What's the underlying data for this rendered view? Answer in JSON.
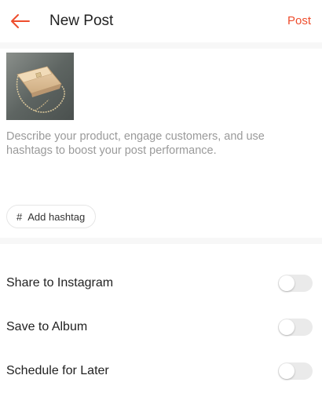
{
  "header": {
    "title": "New Post",
    "post_label": "Post",
    "back_icon": "arrow-left-icon"
  },
  "media": {
    "thumbnail_icon": "product-photo"
  },
  "description": {
    "placeholder": "Describe your product, engage customers, and use hashtags to boost your post performance."
  },
  "hashtag": {
    "symbol": "#",
    "label": "Add hashtag"
  },
  "options": [
    {
      "label": "Share to Instagram",
      "enabled": false
    },
    {
      "label": "Save to Album",
      "enabled": false
    },
    {
      "label": "Schedule for Later",
      "enabled": false
    }
  ],
  "colors": {
    "accent": "#ee4d2d",
    "placeholder_text": "#9a9a9a",
    "toggle_off": "#eaeaea"
  }
}
